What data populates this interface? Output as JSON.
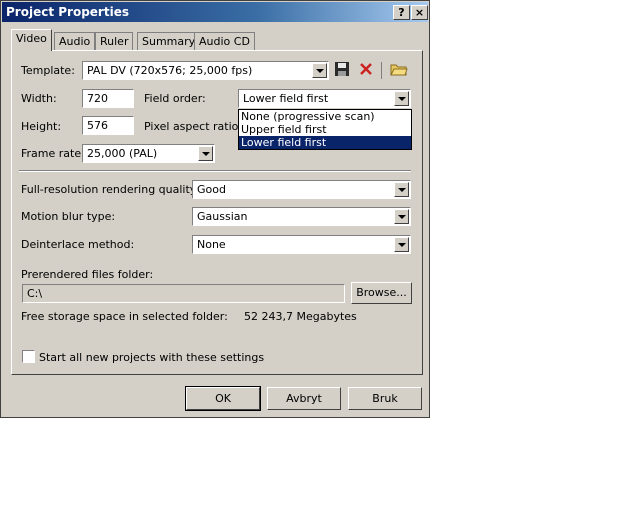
{
  "window": {
    "title": "Project Properties",
    "help_label": "?",
    "close_label": "×"
  },
  "tabs": [
    "Video",
    "Audio",
    "Ruler",
    "Summary",
    "Audio CD"
  ],
  "video": {
    "template_label": "Template:",
    "template_value": "PAL DV (720x576; 25,000 fps)",
    "width_label": "Width:",
    "width_value": "720",
    "height_label": "Height:",
    "height_value": "576",
    "field_order_label": "Field order:",
    "field_order_value": "Lower field first",
    "field_order_options": [
      "None (progressive scan)",
      "Upper field first",
      "Lower field first"
    ],
    "pixel_aspect_label": "Pixel aspect ratio:",
    "frame_rate_label": "Frame rate:",
    "frame_rate_value": "25,000 (PAL)",
    "render_quality_label": "Full-resolution rendering quality:",
    "render_quality_value": "Good",
    "motion_blur_label": "Motion blur type:",
    "motion_blur_value": "Gaussian",
    "deinterlace_label": "Deinterlace method:",
    "deinterlace_value": "None",
    "prerendered_label": "Prerendered files folder:",
    "prerendered_value": "C:\\",
    "browse_label": "Browse...",
    "free_space_label": "Free storage space in selected folder:",
    "free_space_value": "52 243,7 Megabytes",
    "start_all_label": "Start all new projects with these settings"
  },
  "buttons": {
    "ok": "OK",
    "cancel": "Avbryt",
    "apply": "Bruk"
  },
  "icons": {
    "save": "floppy-save-icon",
    "delete": "red-x-delete-icon",
    "open": "folder-open-icon"
  },
  "colors": {
    "title_start": "#0a246a",
    "title_end": "#a6caf0",
    "face": "#d4d0c8",
    "delete_red": "#cc2222"
  }
}
